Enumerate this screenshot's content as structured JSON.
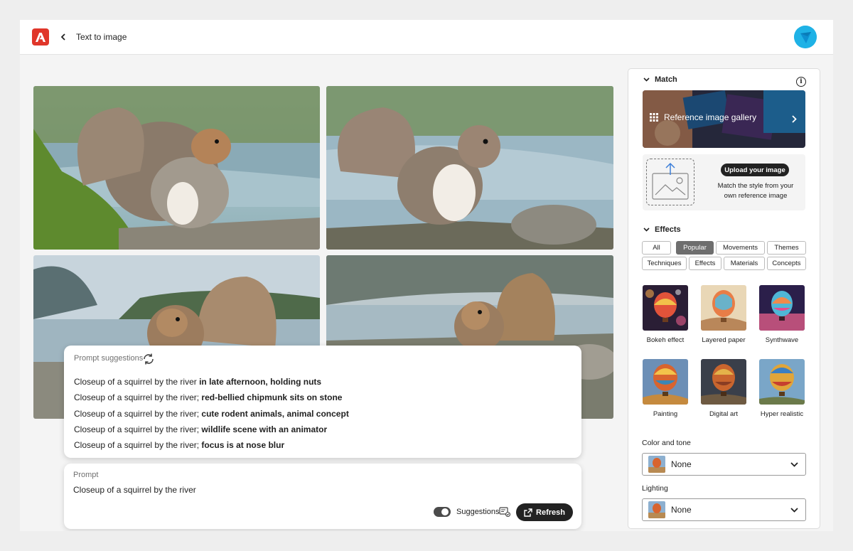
{
  "header": {
    "title": "Text to image",
    "logo_icon": "adobe-logo-icon",
    "back_icon": "chevron-left-icon"
  },
  "images": [
    {
      "alt": "squirrel-1"
    },
    {
      "alt": "squirrel-2"
    },
    {
      "alt": "squirrel-3"
    },
    {
      "alt": "squirrel-4"
    }
  ],
  "suggestions": {
    "heading": "Prompt suggestions",
    "items": [
      {
        "base": "Closeup of a squirrel by the river ",
        "extra": "in late afternoon, holding nuts"
      },
      {
        "base": "Closeup of a squirrel by the river; ",
        "extra": "red-bellied chipmunk sits on stone"
      },
      {
        "base": "Closeup of a squirrel by the river; ",
        "extra": "cute rodent animals, animal concept"
      },
      {
        "base": "Closeup of a squirrel by the river; ",
        "extra": "wildlife scene with an animator"
      },
      {
        "base": "Closeup of a squirrel by the river; ",
        "extra": "focus is at nose blur"
      }
    ]
  },
  "prompt": {
    "label": "Prompt",
    "value": "Closeup of a squirrel by the river",
    "suggestions_toggle_label": "Suggestions",
    "suggestions_toggle_on": true,
    "refresh_label": "Refresh"
  },
  "panel": {
    "match": {
      "heading": "Match",
      "gallery_label": "Reference image gallery",
      "upload_button": "Upload your image",
      "upload_desc": "Match the style from your own reference image"
    },
    "effects": {
      "heading": "Effects",
      "chips_row1": [
        "All",
        "Popular",
        "Movements",
        "Themes"
      ],
      "chips_row2": [
        "Techniques",
        "Effects",
        "Materials",
        "Concepts"
      ],
      "active_chip": "Popular",
      "items": [
        {
          "label": "Bokeh effect"
        },
        {
          "label": "Layered paper"
        },
        {
          "label": "Synthwave"
        },
        {
          "label": "Painting"
        },
        {
          "label": "Digital art"
        },
        {
          "label": "Hyper realistic"
        }
      ]
    },
    "color_tone": {
      "label": "Color and tone",
      "value": "None"
    },
    "lighting": {
      "label": "Lighting",
      "value": "None"
    }
  },
  "colors": {
    "accent": "#e0362a",
    "dark_button": "#222222",
    "active_chip": "#6e6e6e"
  }
}
